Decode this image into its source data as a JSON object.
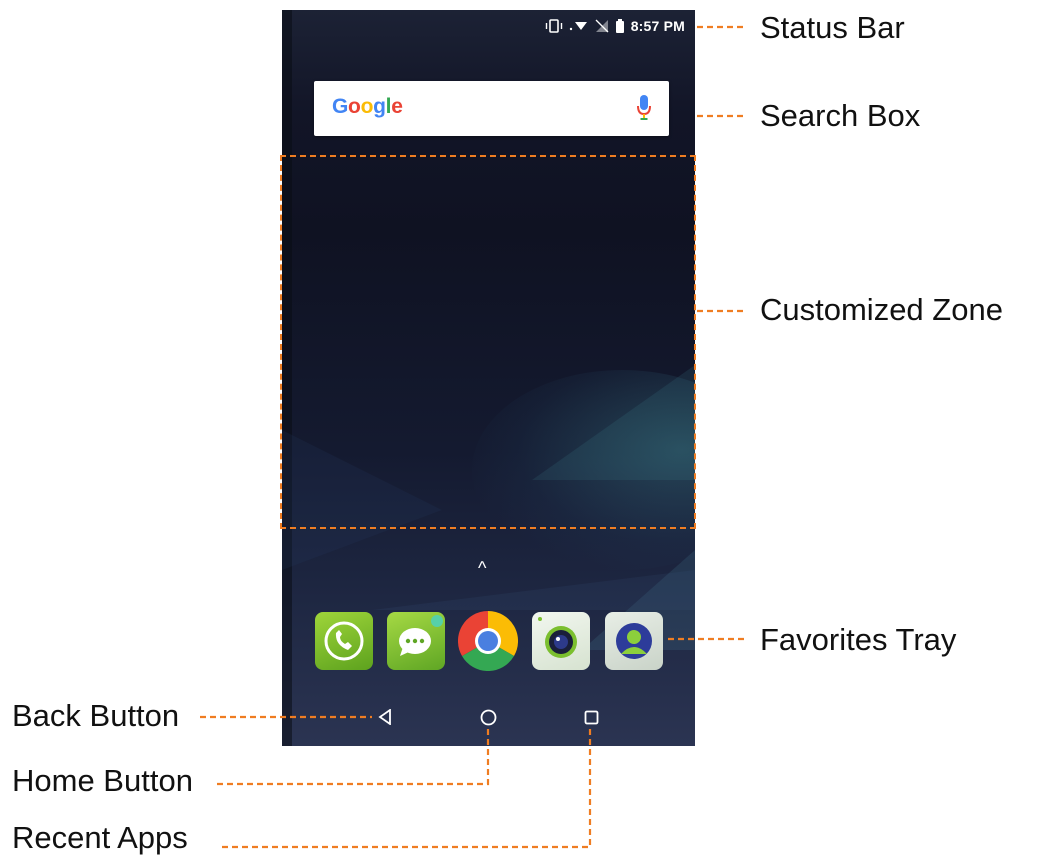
{
  "status_bar": {
    "time": "8:57 PM"
  },
  "search_box": {
    "logo_text": "Google"
  },
  "favorites": [
    {
      "name": "Phone",
      "icon": "phone-icon"
    },
    {
      "name": "Messages",
      "icon": "message-icon"
    },
    {
      "name": "Chrome",
      "icon": "chrome-icon"
    },
    {
      "name": "Camera",
      "icon": "camera-icon"
    },
    {
      "name": "Contacts",
      "icon": "contacts-icon"
    }
  ],
  "annotations": {
    "status_bar": "Status Bar",
    "search_box": "Search Box",
    "customized_zone": "Customized Zone",
    "favorites_tray": "Favorites Tray",
    "back_button": "Back Button",
    "home_button": "Home Button",
    "recent_apps": "Recent Apps"
  },
  "colors": {
    "callout": "#ef7d22"
  }
}
